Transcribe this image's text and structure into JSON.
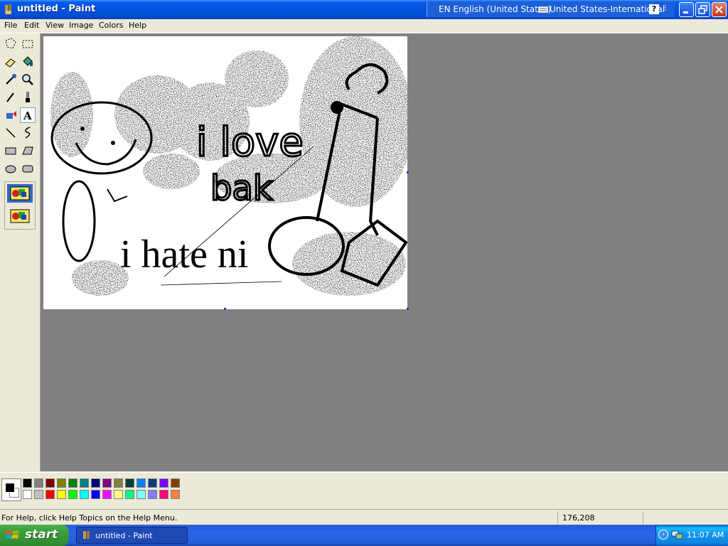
{
  "window": {
    "title": "untitled - Paint"
  },
  "langbar": {
    "language": "EN English (United States)",
    "keyboard": "United States-International",
    "help": "?"
  },
  "menu": [
    "File",
    "Edit",
    "View",
    "Image",
    "Colors",
    "Help"
  ],
  "tools": [
    "free-form-select",
    "select",
    "eraser",
    "fill-with-color",
    "pick-color",
    "magnifier",
    "pencil",
    "brush",
    "airbrush",
    "text",
    "line",
    "curve",
    "rectangle",
    "polygon",
    "ellipse",
    "rounded-rectangle"
  ],
  "active_tool": "text",
  "canvas_text": {
    "line1": "i love",
    "line2": "bak",
    "line3": "i hate ni"
  },
  "palette": {
    "foreground": "#000000",
    "background": "#ffffff",
    "row1": [
      "#000000",
      "#808080",
      "#800000",
      "#808000",
      "#008000",
      "#008080",
      "#000080",
      "#800080",
      "#808040",
      "#004040",
      "#0080ff",
      "#004080",
      "#8000ff",
      "#804000"
    ],
    "row2": [
      "#ffffff",
      "#c0c0c0",
      "#ff0000",
      "#ffff00",
      "#00ff00",
      "#00ffff",
      "#0000ff",
      "#ff00ff",
      "#ffff80",
      "#00ff80",
      "#80ffff",
      "#8080ff",
      "#ff0080",
      "#ff8040"
    ]
  },
  "status": {
    "help_text": "For Help, click Help Topics on the Help Menu.",
    "coords": "176,208"
  },
  "taskbar": {
    "start_label": "start",
    "task_label": "untitled - Paint",
    "clock": "11:07 AM"
  }
}
